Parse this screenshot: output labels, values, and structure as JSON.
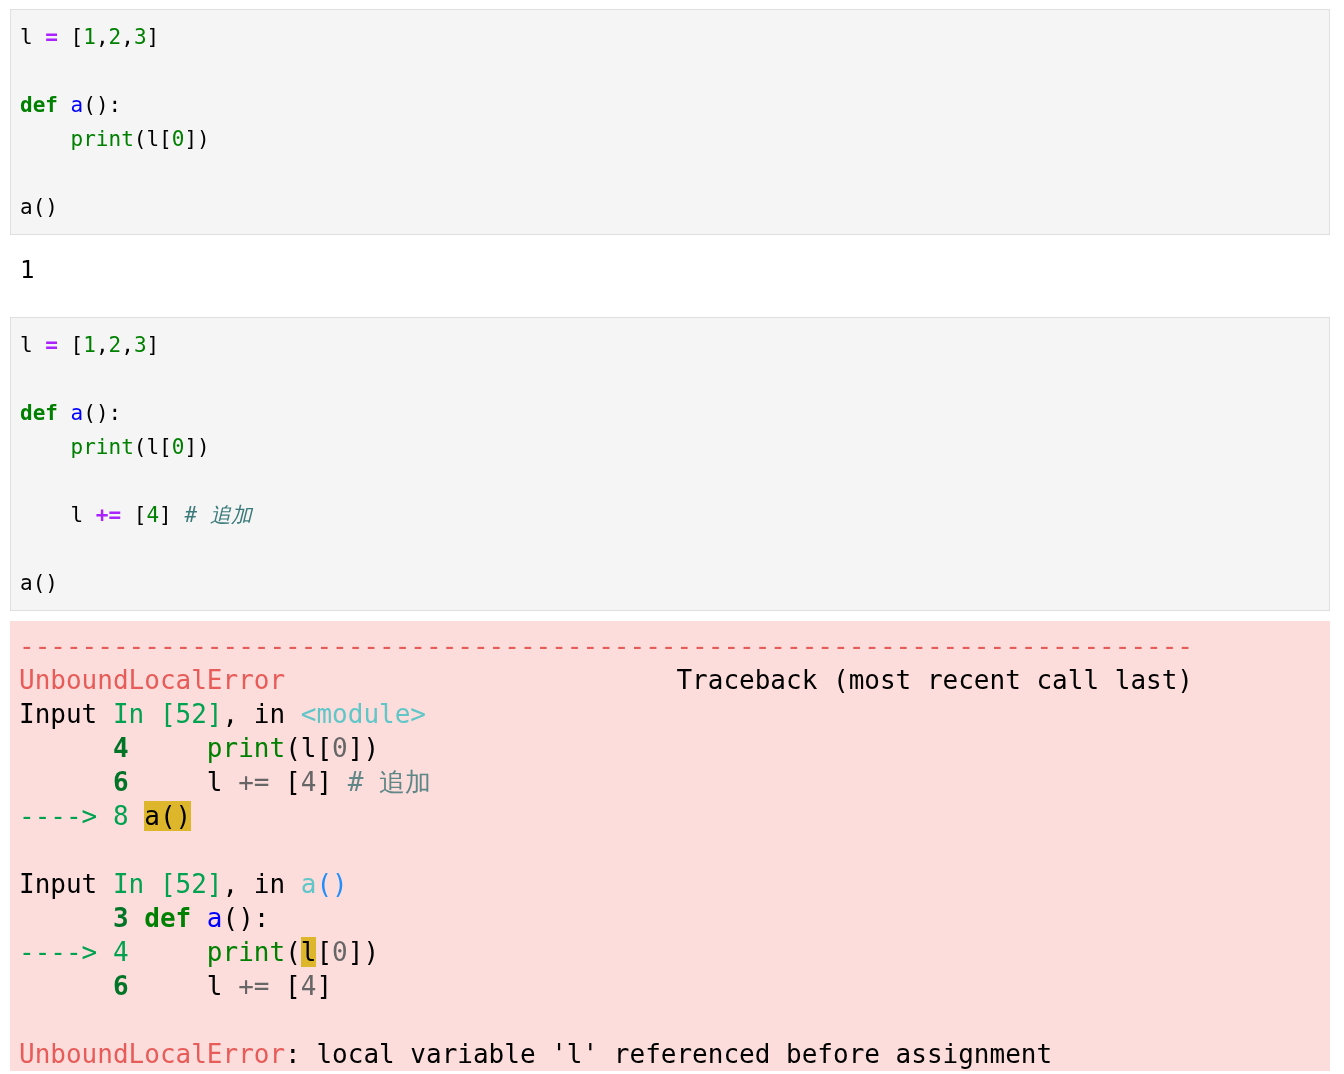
{
  "cells": [
    {
      "kind": "code",
      "blocks": [
        [
          {
            "tokens": [
              {
                "text": "l ",
                "kind": "plain"
              },
              {
                "text": "=",
                "kind": "op"
              },
              {
                "text": " [",
                "kind": "plain"
              },
              {
                "text": "1",
                "kind": "num"
              },
              {
                "text": ",",
                "kind": "plain"
              },
              {
                "text": "2",
                "kind": "num"
              },
              {
                "text": ",",
                "kind": "plain"
              },
              {
                "text": "3",
                "kind": "num"
              },
              {
                "text": "]",
                "kind": "plain"
              }
            ]
          }
        ],
        [
          {
            "tokens": [
              {
                "text": "def ",
                "kind": "kw"
              },
              {
                "text": "a",
                "kind": "fn"
              },
              {
                "text": "():",
                "kind": "plain"
              }
            ]
          },
          {
            "tokens": [
              {
                "text": "    print",
                "kind": "builtin"
              },
              {
                "text": "(l[",
                "kind": "plain"
              },
              {
                "text": "0",
                "kind": "num"
              },
              {
                "text": "])",
                "kind": "plain"
              }
            ]
          }
        ],
        [
          {
            "tokens": [
              {
                "text": "a()",
                "kind": "plain"
              }
            ]
          }
        ]
      ]
    },
    {
      "kind": "output",
      "text": "1"
    },
    {
      "kind": "code",
      "blocks": [
        [
          {
            "tokens": [
              {
                "text": "l ",
                "kind": "plain"
              },
              {
                "text": "=",
                "kind": "op"
              },
              {
                "text": " [",
                "kind": "plain"
              },
              {
                "text": "1",
                "kind": "num"
              },
              {
                "text": ",",
                "kind": "plain"
              },
              {
                "text": "2",
                "kind": "num"
              },
              {
                "text": ",",
                "kind": "plain"
              },
              {
                "text": "3",
                "kind": "num"
              },
              {
                "text": "]",
                "kind": "plain"
              }
            ]
          }
        ],
        [
          {
            "tokens": [
              {
                "text": "def ",
                "kind": "kw"
              },
              {
                "text": "a",
                "kind": "fn"
              },
              {
                "text": "():",
                "kind": "plain"
              }
            ]
          },
          {
            "tokens": [
              {
                "text": "    print",
                "kind": "builtin"
              },
              {
                "text": "(l[",
                "kind": "plain"
              },
              {
                "text": "0",
                "kind": "num"
              },
              {
                "text": "])",
                "kind": "plain"
              }
            ]
          }
        ],
        [
          {
            "tokens": [
              {
                "text": "    l ",
                "kind": "plain"
              },
              {
                "text": "+=",
                "kind": "op"
              },
              {
                "text": " [",
                "kind": "plain"
              },
              {
                "text": "4",
                "kind": "num"
              },
              {
                "text": "] ",
                "kind": "plain"
              },
              {
                "text": "# 追加",
                "kind": "comment"
              }
            ]
          }
        ],
        [
          {
            "tokens": [
              {
                "text": "a()",
                "kind": "plain"
              }
            ]
          }
        ]
      ]
    },
    {
      "kind": "error",
      "blocks": [
        [
          {
            "tokens": [
              {
                "text": "---------------------------------------------------------------------------",
                "kind": "err"
              }
            ]
          },
          {
            "tokens": [
              {
                "text": "UnboundLocalError",
                "kind": "err"
              },
              {
                "text": "                         Traceback (most recent call last)",
                "kind": "plain"
              }
            ]
          },
          {
            "tokens": [
              {
                "text": "Input ",
                "kind": "plain"
              },
              {
                "text": "In [52]",
                "kind": "ok"
              },
              {
                "text": ", in ",
                "kind": "plain"
              },
              {
                "text": "<module>",
                "kind": "cyan"
              }
            ]
          },
          {
            "tokens": [
              {
                "text": "      4     ",
                "kind": "lineno"
              },
              {
                "text": "print",
                "kind": "builtin"
              },
              {
                "text": "(l[",
                "kind": "plain"
              },
              {
                "text": "0",
                "kind": "gray"
              },
              {
                "text": "])",
                "kind": "plain"
              }
            ]
          },
          {
            "tokens": [
              {
                "text": "      6",
                "kind": "lineno"
              },
              {
                "text": "     l ",
                "kind": "plain"
              },
              {
                "text": "+=",
                "kind": "gray"
              },
              {
                "text": " [",
                "kind": "plain"
              },
              {
                "text": "4",
                "kind": "gray"
              },
              {
                "text": "] ",
                "kind": "plain"
              },
              {
                "text": "# 追加",
                "kind": "tbcomment"
              }
            ]
          },
          {
            "tokens": [
              {
                "text": "----> 8 ",
                "kind": "ok"
              },
              {
                "text": "a()",
                "kind": "hl"
              }
            ]
          }
        ],
        [
          {
            "tokens": [
              {
                "text": "Input ",
                "kind": "plain"
              },
              {
                "text": "In [52]",
                "kind": "ok"
              },
              {
                "text": ", in ",
                "kind": "plain"
              },
              {
                "text": "a",
                "kind": "cyan"
              },
              {
                "text": "()",
                "kind": "blue"
              }
            ]
          },
          {
            "tokens": [
              {
                "text": "      3 ",
                "kind": "lineno"
              },
              {
                "text": "def ",
                "kind": "kw"
              },
              {
                "text": "a",
                "kind": "fn"
              },
              {
                "text": "():",
                "kind": "plain"
              }
            ]
          },
          {
            "tokens": [
              {
                "text": "----> 4     ",
                "kind": "ok"
              },
              {
                "text": "print",
                "kind": "builtin"
              },
              {
                "text": "(",
                "kind": "plain"
              },
              {
                "text": "l",
                "kind": "hl"
              },
              {
                "text": "[",
                "kind": "plain"
              },
              {
                "text": "0",
                "kind": "gray"
              },
              {
                "text": "])",
                "kind": "plain"
              }
            ]
          },
          {
            "tokens": [
              {
                "text": "      6",
                "kind": "lineno"
              },
              {
                "text": "     l ",
                "kind": "plain"
              },
              {
                "text": "+=",
                "kind": "gray"
              },
              {
                "text": " [",
                "kind": "plain"
              },
              {
                "text": "4",
                "kind": "gray"
              },
              {
                "text": "]",
                "kind": "plain"
              }
            ]
          }
        ],
        [
          {
            "tokens": [
              {
                "text": "UnboundLocalError",
                "kind": "err"
              },
              {
                "text": ": local variable 'l' referenced before assignment",
                "kind": "plain"
              }
            ]
          }
        ]
      ]
    }
  ]
}
